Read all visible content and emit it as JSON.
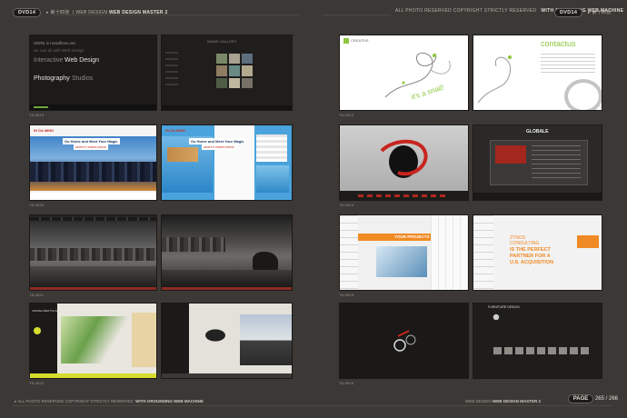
{
  "header": {
    "left_pill": "DVD14",
    "left_code": "▸ 第十四张",
    "left_series": "WEB DESIGN",
    "left_title": "WEB DESIGN MASTER 2",
    "right_notice": "ALL PHOTO RESERVED COPYRIGHT STRICTLY RESERVED",
    "right_brand": "WITH GROUNDING WEB MACHINE",
    "right_pill": "DVD14",
    "right_code": "▸ 第十四张"
  },
  "footer": {
    "left_notice": "ALL PHOTO RESERVED COPYRIGHT STRICTLY RESERVED",
    "left_brand": "WITH GROUNDING WEB MACHINE",
    "right_series": "WEB DESIGN",
    "right_title": "WEB DESIGN MASTER 2",
    "page_label": "PAGE",
    "page_numbers": "265 / 266"
  },
  "left_page": {
    "captions": [
      "T8-0019",
      "T8-0020",
      "T8-0021",
      "T8-0022"
    ],
    "shot1": {
      "line1": "HERE is Headlines.net",
      "line2": "we can do with Web Design",
      "line3": "Interactive",
      "line4": "Web Design",
      "line5": "Photography",
      "line6": "Studios"
    },
    "shot2": {
      "title": "IMAGE GALLERY"
    },
    "shot3": {
      "logo": "IN DA MIND",
      "banner": "Go Home and Meet Your Magic",
      "banner2": "where it makes sense"
    },
    "shot4": {
      "logo": "IN DA MIND",
      "banner": "Go Home and Meet Your Magic",
      "banner2": "where it makes sense"
    },
    "shot7": {
      "logo": "ANDREA BERTOLINI"
    }
  },
  "right_page": {
    "captions": [
      "T8-0023",
      "T8-0024",
      "T8-0025",
      "T8-0026"
    ],
    "shot1": {
      "logo": "CREATIVE",
      "slogan": "it's a snail!"
    },
    "shot2": {
      "title": "contactus"
    },
    "shot4": {
      "title": "GLOBALE"
    },
    "shot5": {
      "heading": "YOUR PROJECTS"
    },
    "shot6": {
      "line1": "ZYNOS",
      "line2": "CONSULTING",
      "line3": "IS THE PERFECT",
      "line4": "PARTNER FOR A",
      "line5": "U.S. ACQUISITION"
    },
    "shot8": {
      "label": "FURNITURE DESIGN"
    }
  }
}
